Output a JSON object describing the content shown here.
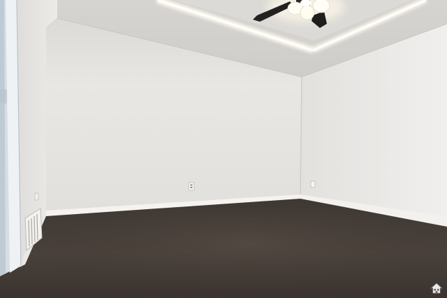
{
  "scene": {
    "type": "empty room interior",
    "colors": {
      "back_wall": "#e6e4e1",
      "right_wall": "#ecebe9",
      "left_wall": "#e7e6e3",
      "ceiling": "#d9d7d4",
      "tray_ceiling": "#dedcd9",
      "carpet": "#4a423d",
      "baseboard": "#f2f1ee",
      "fan": "#1f1f1f",
      "light": "#fff8e6"
    },
    "objects": [
      "ceiling-fan",
      "tray-ceiling-lighting",
      "carpet",
      "baseboards",
      "electrical-outlets",
      "floor-vent",
      "door-frame"
    ]
  },
  "watermark": {
    "icon": "house-logo-icon"
  }
}
